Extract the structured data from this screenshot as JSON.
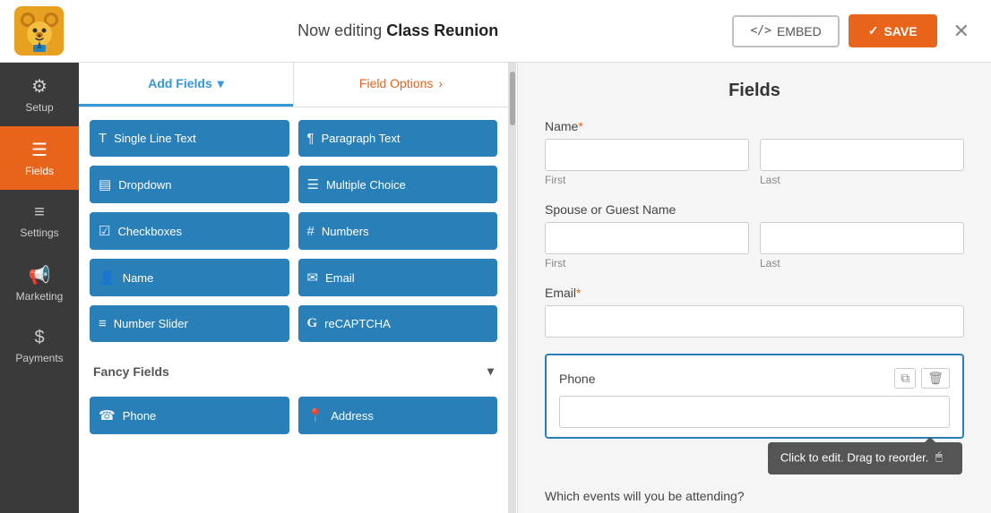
{
  "topbar": {
    "title_prefix": "Now editing ",
    "title_strong": "Class Reunion",
    "embed_label": "EMBED",
    "save_label": "SAVE",
    "close_label": "✕"
  },
  "left_nav": {
    "items": [
      {
        "id": "setup",
        "label": "Setup",
        "icon": "⚙"
      },
      {
        "id": "fields",
        "label": "Fields",
        "icon": "☰",
        "active": true
      },
      {
        "id": "settings",
        "label": "Settings",
        "icon": "≡"
      },
      {
        "id": "marketing",
        "label": "Marketing",
        "icon": "📢"
      },
      {
        "id": "payments",
        "label": "Payments",
        "icon": "$"
      }
    ]
  },
  "panel": {
    "tab_add": "Add Fields",
    "tab_options": "Field Options",
    "fields": [
      {
        "id": "single-line-text",
        "label": "Single Line Text",
        "icon": "T"
      },
      {
        "id": "paragraph-text",
        "label": "Paragraph Text",
        "icon": "¶"
      },
      {
        "id": "dropdown",
        "label": "Dropdown",
        "icon": "▤"
      },
      {
        "id": "multiple-choice",
        "label": "Multiple Choice",
        "icon": "☰"
      },
      {
        "id": "checkboxes",
        "label": "Checkboxes",
        "icon": "☑"
      },
      {
        "id": "numbers",
        "label": "Numbers",
        "icon": "#"
      },
      {
        "id": "name",
        "label": "Name",
        "icon": "👤"
      },
      {
        "id": "email",
        "label": "Email",
        "icon": "✉"
      },
      {
        "id": "number-slider",
        "label": "Number Slider",
        "icon": "≡"
      },
      {
        "id": "recaptcha",
        "label": "reCAPTCHA",
        "icon": "G"
      }
    ],
    "fancy_fields_label": "Fancy Fields",
    "fancy_fields": [
      {
        "id": "phone",
        "label": "Phone",
        "icon": "☎"
      },
      {
        "id": "address",
        "label": "Address",
        "icon": "📍"
      }
    ]
  },
  "form": {
    "section_label": "Fields",
    "name_label": "Name",
    "name_required": "*",
    "name_first_sublabel": "First",
    "name_last_sublabel": "Last",
    "spouse_label": "Spouse or Guest Name",
    "spouse_first_sublabel": "First",
    "spouse_last_sublabel": "Last",
    "email_label": "Email",
    "email_required": "*",
    "phone_label": "Phone",
    "tooltip_text": "Click to edit. Drag to reorder.",
    "which_events_label": "Which events will you be attending?"
  }
}
